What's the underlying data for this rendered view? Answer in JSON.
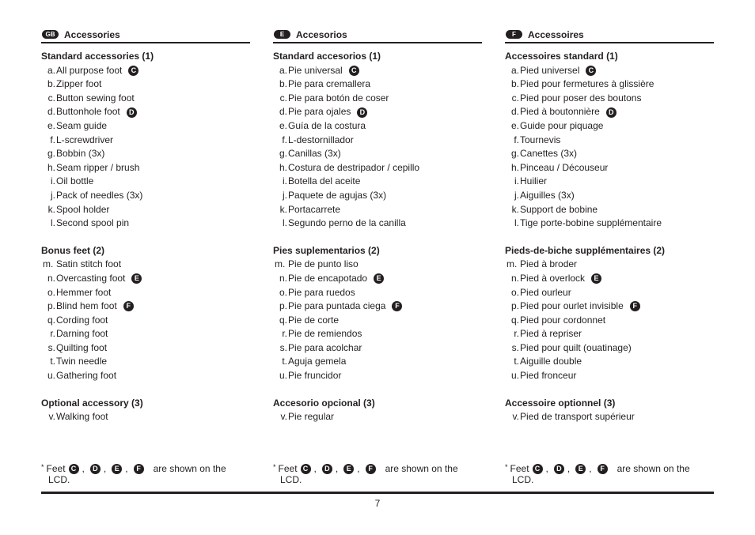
{
  "columns": [
    {
      "lang_badge": "GB",
      "title": "Accessories",
      "sections": [
        {
          "title": "Standard accessories (1)",
          "items": [
            {
              "label": "a.",
              "text": "All purpose foot",
              "badge": "C"
            },
            {
              "label": "b.",
              "text": "Zipper foot"
            },
            {
              "label": "c.",
              "text": "Button sewing foot"
            },
            {
              "label": "d.",
              "text": "Buttonhole foot",
              "badge": "D"
            },
            {
              "label": "e.",
              "text": "Seam guide"
            },
            {
              "label": "f.",
              "text": "L-screwdriver"
            },
            {
              "label": "g.",
              "text": "Bobbin (3x)"
            },
            {
              "label": "h.",
              "text": "Seam ripper / brush"
            },
            {
              "label": "i.",
              "text": "Oil bottle"
            },
            {
              "label": "j.",
              "text": "Pack of needles (3x)"
            },
            {
              "label": "k.",
              "text": "Spool holder"
            },
            {
              "label": "l.",
              "text": "Second spool pin"
            }
          ]
        },
        {
          "title": "Bonus feet (2)",
          "items": [
            {
              "label": "m.",
              "text": "Satin stitch foot"
            },
            {
              "label": "n.",
              "text": "Overcasting foot",
              "badge": "E"
            },
            {
              "label": "o.",
              "text": "Hemmer foot"
            },
            {
              "label": "p.",
              "text": "Blind hem foot",
              "badge": "F"
            },
            {
              "label": "q.",
              "text": "Cording foot"
            },
            {
              "label": "r.",
              "text": "Darning foot"
            },
            {
              "label": "s.",
              "text": "Quilting foot"
            },
            {
              "label": "t.",
              "text": "Twin needle"
            },
            {
              "label": "u.",
              "text": "Gathering foot"
            }
          ]
        },
        {
          "title": "Optional accessory (3)",
          "items": [
            {
              "label": "v.",
              "text": "Walking foot"
            }
          ]
        }
      ],
      "note": {
        "asterisk": "*",
        "prefix": "Feet",
        "badges": [
          "C",
          "D",
          "E",
          "F"
        ],
        "separator": ",",
        "suffix": "are shown on the",
        "line2": "LCD."
      }
    },
    {
      "lang_badge": "E",
      "title": "Accesorios",
      "sections": [
        {
          "title": "Standard accesorios (1)",
          "items": [
            {
              "label": "a.",
              "text": "Pie universal",
              "badge": "C"
            },
            {
              "label": "b.",
              "text": "Pie para cremallera"
            },
            {
              "label": "c.",
              "text": "Pie para botón de coser"
            },
            {
              "label": "d.",
              "text": "Pie para ojales",
              "badge": "D"
            },
            {
              "label": "e.",
              "text": "Guía de la costura"
            },
            {
              "label": "f.",
              "text": "L-destornillador"
            },
            {
              "label": "g.",
              "text": "Canillas (3x)"
            },
            {
              "label": "h.",
              "text": "Costura de destripador / cepillo"
            },
            {
              "label": "i.",
              "text": "Botella del aceite"
            },
            {
              "label": "j.",
              "text": "Paquete de agujas (3x)"
            },
            {
              "label": "k.",
              "text": "Portacarrete"
            },
            {
              "label": "l.",
              "text": "Segundo perno de la canilla"
            }
          ]
        },
        {
          "title": "Pies suplementarios (2)",
          "items": [
            {
              "label": "m.",
              "text": "Pie de punto liso"
            },
            {
              "label": "n.",
              "text": "Pie de encapotado",
              "badge": "E"
            },
            {
              "label": "o.",
              "text": "Pie para ruedos"
            },
            {
              "label": "p.",
              "text": "Pie para puntada ciega",
              "badge": "F"
            },
            {
              "label": "q.",
              "text": "Pie de corte"
            },
            {
              "label": "r.",
              "text": "Pie de remiendos"
            },
            {
              "label": "s.",
              "text": "Pie para acolchar"
            },
            {
              "label": "t.",
              "text": "Aguja gemela"
            },
            {
              "label": "u.",
              "text": "Pie fruncidor"
            }
          ]
        },
        {
          "title": "Accesorio opcional (3)",
          "items": [
            {
              "label": "v.",
              "text": "Pie regular"
            }
          ]
        }
      ],
      "note": {
        "asterisk": "*",
        "prefix": "Feet",
        "badges": [
          "C",
          "D",
          "E",
          "F"
        ],
        "separator": ",",
        "suffix": "are shown on the",
        "line2": "LCD."
      }
    },
    {
      "lang_badge": "F",
      "title": "Accessoires",
      "sections": [
        {
          "title": "Accessoires standard (1)",
          "items": [
            {
              "label": "a.",
              "text": "Pied universel",
              "badge": "C"
            },
            {
              "label": "b.",
              "text": "Pied pour fermetures à glissière"
            },
            {
              "label": "c.",
              "text": "Pied pour poser des boutons"
            },
            {
              "label": "d.",
              "text": "Pied à boutonnière",
              "badge": "D"
            },
            {
              "label": "e.",
              "text": "Guide pour piquage"
            },
            {
              "label": "f.",
              "text": "Tournevis"
            },
            {
              "label": "g.",
              "text": "Canettes (3x)"
            },
            {
              "label": "h.",
              "text": "Pinceau / Découseur"
            },
            {
              "label": "i.",
              "text": "Huilier"
            },
            {
              "label": "j.",
              "text": "Aiguilles (3x)"
            },
            {
              "label": "k.",
              "text": "Support de bobine"
            },
            {
              "label": "l.",
              "text": "Tige porte-bobine supplémentaire"
            }
          ]
        },
        {
          "title": "Pieds-de-biche supplémentaires (2)",
          "items": [
            {
              "label": "m.",
              "text": "Pied à broder"
            },
            {
              "label": "n.",
              "text": "Pied à overlock",
              "badge": "E"
            },
            {
              "label": "o.",
              "text": "Pied ourleur"
            },
            {
              "label": "p.",
              "text": "Pied pour ourlet invisible",
              "badge": "F"
            },
            {
              "label": "q.",
              "text": "Pied pour cordonnet"
            },
            {
              "label": "r.",
              "text": "Pied à repriser"
            },
            {
              "label": "s.",
              "text": "Pied pour quilt (ouatinage)"
            },
            {
              "label": "t.",
              "text": "Aiguille double"
            },
            {
              "label": "u.",
              "text": "Pied fronceur"
            }
          ]
        },
        {
          "title": "Accessoire optionnel (3)",
          "items": [
            {
              "label": "v.",
              "text": "Pied de transport supérieur"
            }
          ]
        }
      ],
      "note": {
        "asterisk": "*",
        "prefix": "Feet",
        "badges": [
          "C",
          "D",
          "E",
          "F"
        ],
        "separator": ",",
        "suffix": "are shown on the",
        "line2": "LCD."
      }
    }
  ],
  "page_number": "7",
  "colors": {
    "ink": "#231f20",
    "background": "#ffffff"
  }
}
